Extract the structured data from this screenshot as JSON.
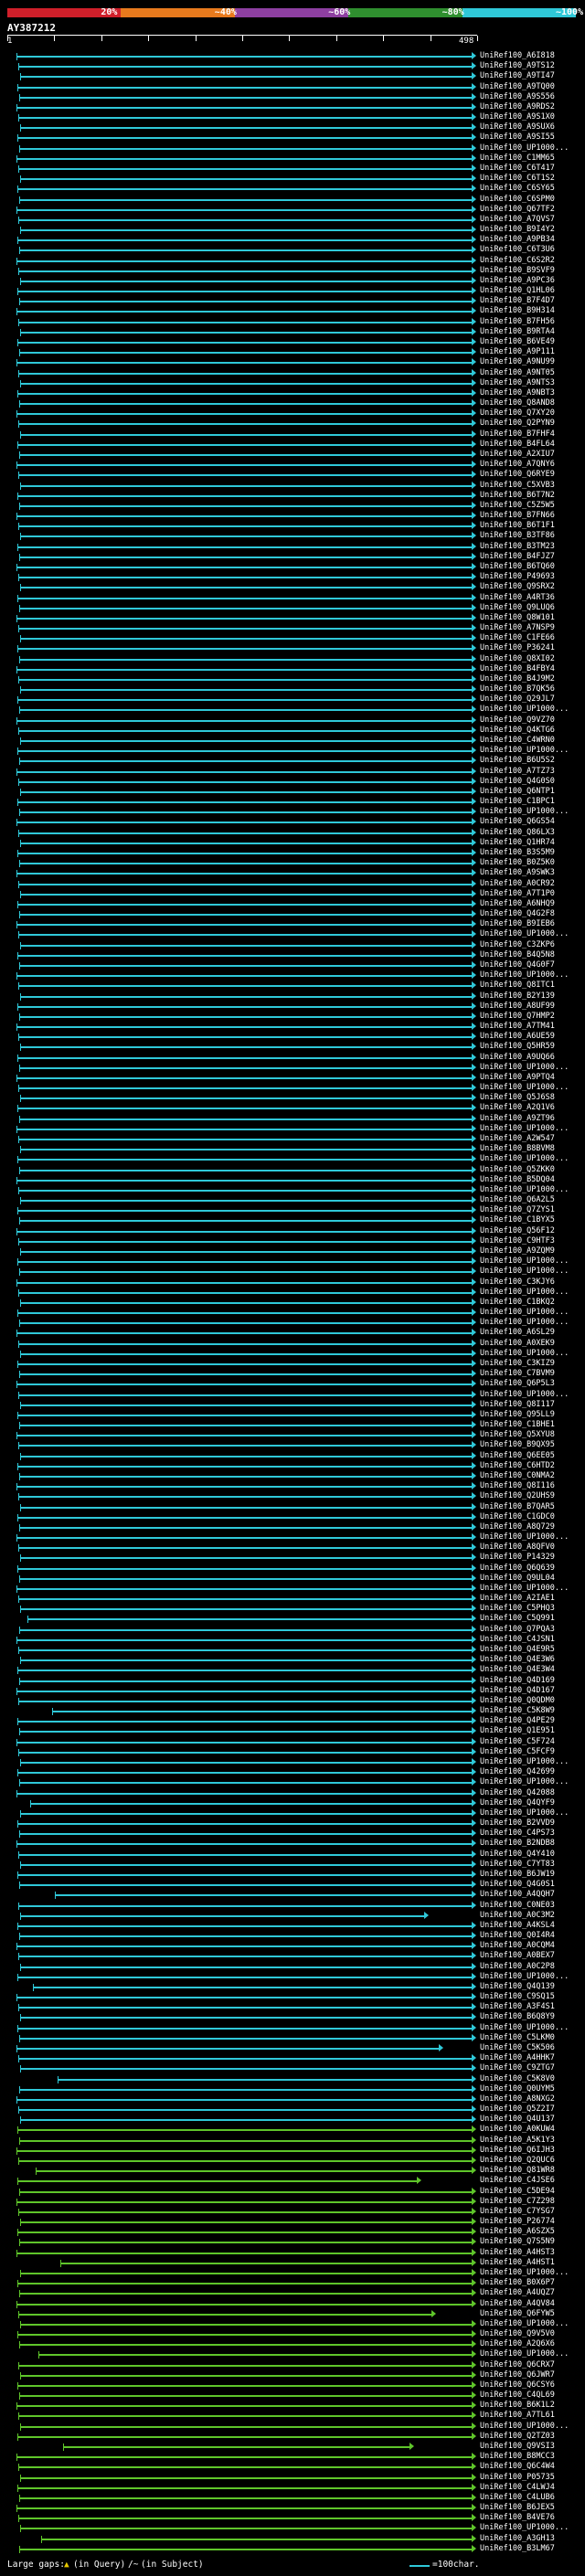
{
  "legend": {
    "labels": [
      "20%",
      "~40%",
      "~60%",
      "~80%",
      "~100%"
    ],
    "colors": [
      "#d01f2a",
      "#e87a1d",
      "#8e3fa1",
      "#2f8f2f",
      "#2fc8d8"
    ]
  },
  "query_id": "AY387212",
  "ruler": {
    "start": "1",
    "end": "498"
  },
  "hits": [
    "UniRef100_A6I818",
    "UniRef100_A9TS12",
    "UniRef100_A9TI47",
    "UniRef100_A9TQ00",
    "UniRef100_A9S556",
    "UniRef100_A9RDS2",
    "UniRef100_A9S1X0",
    "UniRef100_A9SUX6",
    "UniRef100_A9SI55",
    "UniRef100_UP1000...",
    "UniRef100_C1MM65",
    "UniRef100_C6T417",
    "UniRef100_C6T1S2",
    "UniRef100_C6SY65",
    "UniRef100_C6SPM0",
    "UniRef100_Q67TF2",
    "UniRef100_A7QVS7",
    "UniRef100_B9I4Y2",
    "UniRef100_A9PB34",
    "UniRef100_C6T3U6",
    "UniRef100_C6S2R2",
    "UniRef100_B9SVF9",
    "UniRef100_A9PC36",
    "UniRef100_Q1HL06",
    "UniRef100_B7F4D7",
    "UniRef100_B9H314",
    "UniRef100_B7FH56",
    "UniRef100_B9RTA4",
    "UniRef100_B6VE49",
    "UniRef100_A9P111",
    "UniRef100_A9NU99",
    "UniRef100_A9NT05",
    "UniRef100_A9NTS3",
    "UniRef100_A9NBT3",
    "UniRef100_Q8AND8",
    "UniRef100_Q7XY20",
    "UniRef100_Q2PYN9",
    "UniRef100_B7FHF4",
    "UniRef100_B4FL64",
    "UniRef100_A2XIU7",
    "UniRef100_A7QNY6",
    "UniRef100_Q6RYE9",
    "UniRef100_C5XVB3",
    "UniRef100_B6T7N2",
    "UniRef100_C5Z5W5",
    "UniRef100_B7FN66",
    "UniRef100_B6T1F1",
    "UniRef100_B3TF86",
    "UniRef100_B3TM23",
    "UniRef100_B4FJZ7",
    "UniRef100_B6TQ60",
    "UniRef100_P49693",
    "UniRef100_Q9SRX2",
    "UniRef100_A4RT36",
    "UniRef100_Q9LUQ6",
    "UniRef100_Q8W101",
    "UniRef100_A7NSP9",
    "UniRef100_C1FE66",
    "UniRef100_P36241",
    "UniRef100_Q8XI02",
    "UniRef100_B4FBY4",
    "UniRef100_B4J9M2",
    "UniRef100_B7QK56",
    "UniRef100_Q29JL7",
    "UniRef100_UP1000...",
    "UniRef100_Q9VZ70",
    "UniRef100_Q4KTG6",
    "UniRef100_C4WRN0",
    "UniRef100_UP1000...",
    "UniRef100_B6U5S2",
    "UniRef100_A7TZ73",
    "UniRef100_Q4G0S0",
    "UniRef100_Q6NTP1",
    "UniRef100_C1BPC1",
    "UniRef100_UP1000...",
    "UniRef100_Q6GS54",
    "UniRef100_Q86LX3",
    "UniRef100_Q1HR74",
    "UniRef100_B3S5M9",
    "UniRef100_B0Z5K0",
    "UniRef100_A9SWK3",
    "UniRef100_A0CR92",
    "UniRef100_A7T1P0",
    "UniRef100_A6NHQ9",
    "UniRef100_Q4G2F8",
    "UniRef100_B9IEB6",
    "UniRef100_UP1000...",
    "UniRef100_C3ZKP6",
    "UniRef100_B4Q5N8",
    "UniRef100_Q4G0F7",
    "UniRef100_UP1000...",
    "UniRef100_Q8ITC1",
    "UniRef100_B2Y139",
    "UniRef100_A8UF99",
    "UniRef100_Q7HMP2",
    "UniRef100_A7TM41",
    "UniRef100_A6UE59",
    "UniRef100_Q5HR59",
    "UniRef100_A9UQ66",
    "UniRef100_UP1000...",
    "UniRef100_A9PTQ4",
    "UniRef100_UP1000...",
    "UniRef100_Q5J6S8",
    "UniRef100_A2Q1V6",
    "UniRef100_A9ZT96",
    "UniRef100_UP1000...",
    "UniRef100_A2W547",
    "UniRef100_B8BVM8",
    "UniRef100_UP1000...",
    "UniRef100_Q5ZKK0",
    "UniRef100_B5DQ04",
    "UniRef100_UP1000...",
    "UniRef100_Q6A2L5",
    "UniRef100_Q7ZYS1",
    "UniRef100_C1BYX5",
    "UniRef100_Q56F12",
    "UniRef100_C9HTF3",
    "UniRef100_A9ZQM9",
    "UniRef100_UP1000...",
    "UniRef100_UP1000...",
    "UniRef100_C3KJY6",
    "UniRef100_UP1000...",
    "UniRef100_C1BKQ2",
    "UniRef100_UP1000...",
    "UniRef100_UP1000...",
    "UniRef100_A6SL29",
    "UniRef100_A0XEK9",
    "UniRef100_UP1000...",
    "UniRef100_C3KIZ9",
    "UniRef100_C7BVM9",
    "UniRef100_Q6P5L3",
    "UniRef100_UP1000...",
    "UniRef100_Q8I117",
    "UniRef100_Q95LL9",
    "UniRef100_C1BHE1",
    "UniRef100_Q5XYU8",
    "UniRef100_B9QX95",
    "UniRef100_Q6EE05",
    "UniRef100_C6HTD2",
    "UniRef100_C0NMA2",
    "UniRef100_Q8I116",
    "UniRef100_Q2UHS9",
    "UniRef100_B7QAR5",
    "UniRef100_C1GDC0",
    "UniRef100_A8Q729",
    "UniRef100_UP1000...",
    "UniRef100_A8QFV0",
    "UniRef100_P14329",
    "UniRef100_Q6Q639",
    "UniRef100_Q9UL04",
    "UniRef100_UP1000...",
    "UniRef100_A2IAE1",
    "UniRef100_C5PHQ3",
    "UniRef100_C5Q991",
    "UniRef100_Q7PQA3",
    "UniRef100_C4JSN1",
    "UniRef100_Q4E9R5",
    "UniRef100_Q4E3W6",
    "UniRef100_Q4E3W4",
    "UniRef100_Q4D169",
    "UniRef100_Q4D167",
    "UniRef100_Q0QDM0",
    "UniRef100_C5K8W9",
    "UniRef100_Q4PE29",
    "UniRef100_Q1E951",
    "UniRef100_C5F724",
    "UniRef100_C5FCF9",
    "UniRef100_UP1000...",
    "UniRef100_Q42699",
    "UniRef100_UP1000...",
    "UniRef100_Q42088",
    "UniRef100_Q4QYF9",
    "UniRef100_UP1000...",
    "UniRef100_B2VVD9",
    "UniRef100_C4PS73",
    "UniRef100_B2NDB8",
    "UniRef100_Q4Y410",
    "UniRef100_C7YT83",
    "UniRef100_B6JW19",
    "UniRef100_Q4G0S1",
    "UniRef100_A4QQH7",
    "UniRef100_C0NE03",
    "UniRef100_A0C3M2",
    "UniRef100_A4KSL4",
    "UniRef100_Q0I4R4",
    "UniRef100_A0CQM4",
    "UniRef100_A0BEX7",
    "UniRef100_A0C2P8",
    "UniRef100_UP1000...",
    "UniRef100_Q4Q139",
    "UniRef100_C9SQ15",
    "UniRef100_A3F4S1",
    "UniRef100_B6Q8Y9",
    "UniRef100_UP1000...",
    "UniRef100_C5LKM0",
    "UniRef100_C5K506",
    "UniRef100_A4HHK7",
    "UniRef100_C9ZTG7",
    "UniRef100_C5K8V0",
    "UniRef100_Q0UYM5",
    "UniRef100_A8NXG2",
    "UniRef100_Q5Z2I7",
    "UniRef100_Q4U137",
    "UniRef100_A0KUW4",
    "UniRef100_A5K1Y3",
    "UniRef100_Q6IJH3",
    "UniRef100_Q2QUC6",
    "UniRef100_Q81WR8",
    "UniRef100_C4JSE6",
    "UniRef100_C5DE94",
    "UniRef100_C7Z298",
    "UniRef100_C7YSG7",
    "UniRef100_P26774",
    "UniRef100_A6SZX5",
    "UniRef100_Q7S5N9",
    "UniRef100_A4HST3",
    "UniRef100_A4HST1",
    "UniRef100_UP1000...",
    "UniRef100_B0X6P7",
    "UniRef100_A4UQZ7",
    "UniRef100_A4QV84",
    "UniRef100_Q6FYW5",
    "UniRef100_UP1000...",
    "UniRef100_Q9V5V0",
    "UniRef100_A2Q6X6",
    "UniRef100_UP1000...",
    "UniRef100_Q6CRX7",
    "UniRef100_Q6JWR7",
    "UniRef100_Q6CSY6",
    "UniRef100_C4QL69",
    "UniRef100_B6K1L2",
    "UniRef100_A7TL61",
    "UniRef100_UP1000...",
    "UniRef100_Q2TZ03",
    "UniRef100_Q9VSI3",
    "UniRef100_B8MCC3",
    "UniRef100_Q6C4W4",
    "UniRef100_P05735",
    "UniRef100_C4LWJ4",
    "UniRef100_C4LUB6",
    "UniRef100_B6JEX5",
    "UniRef100_B4VE76",
    "UniRef100_UP1000...",
    "UniRef100_A3GH13",
    "UniRef100_B3LM67"
  ],
  "footer": {
    "gaps_label": "Large gaps:",
    "in_query": "(in Query)",
    "separator": "/~",
    "in_subject": "(in Subject)",
    "scale_label": "=100char."
  }
}
